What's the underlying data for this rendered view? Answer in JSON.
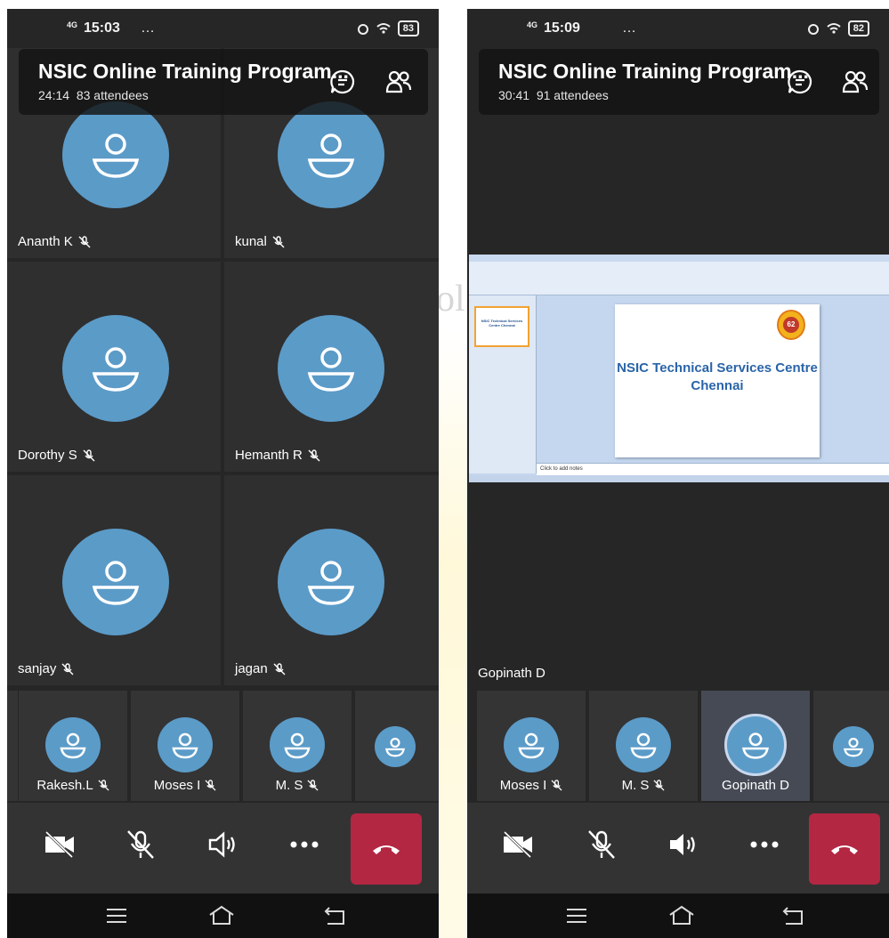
{
  "watermark": {
    "text": "ol"
  },
  "left": {
    "status": {
      "network": "4G",
      "time": "15:03",
      "extra": "…",
      "battery": "83"
    },
    "header": {
      "title": "NSIC Online Training Program...",
      "duration": "24:14",
      "attendees": "83 attendees"
    },
    "grid": [
      {
        "name": "Ananth K"
      },
      {
        "name": "kunal"
      },
      {
        "name": "Dorothy S"
      },
      {
        "name": "Hemanth R"
      },
      {
        "name": "sanjay"
      },
      {
        "name": "jagan"
      }
    ],
    "strip": [
      {
        "name": "Rakesh.L"
      },
      {
        "name": "Moses I"
      },
      {
        "name": "M. S"
      }
    ]
  },
  "right": {
    "status": {
      "network": "4G",
      "time": "15:09",
      "extra": "…",
      "battery": "82"
    },
    "header": {
      "title": "NSIC Online Training Program...",
      "duration": "30:41",
      "attendees": "91 attendees"
    },
    "presenter": "Gopinath D",
    "slide": {
      "title_line1": "NSIC Technical Services Centre",
      "title_line2": "Chennai",
      "thumb_text": "NSIC Technical Services Centre Chennai",
      "notes": "Click to add notes",
      "logo_text": "62"
    },
    "strip": [
      {
        "name": "Moses I"
      },
      {
        "name": "M. S"
      },
      {
        "name": "Gopinath D"
      }
    ]
  },
  "colors": {
    "avatar": "#5b9bc8",
    "hangup": "#b32743",
    "panel": "#262626"
  },
  "icons": [
    "chat-icon",
    "participants-icon",
    "camera-off-icon",
    "mic-off-icon",
    "speaker-icon",
    "more-icon",
    "hangup-icon",
    "mute-indicator-icon"
  ]
}
